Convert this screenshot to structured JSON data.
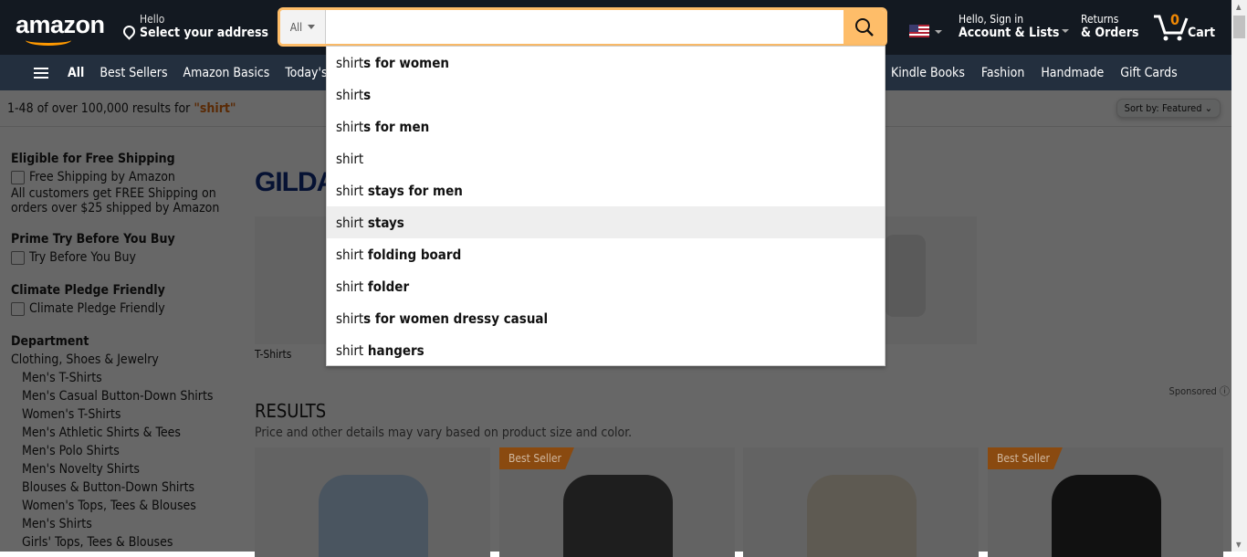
{
  "header": {
    "logo": "amazon",
    "hello": "Hello",
    "address": "Select your address",
    "search_category": "All",
    "search_value": "",
    "account_small": "Hello, Sign in",
    "account_big": "Account & Lists",
    "returns_small": "Returns",
    "returns_big": "& Orders",
    "cart_count": "0",
    "cart_label": "Cart"
  },
  "nav": {
    "all": "All",
    "items": [
      "Best Sellers",
      "Amazon Basics",
      "Today's Deals"
    ],
    "right_items": [
      "Kindle Books",
      "Fashion",
      "Handmade",
      "Gift Cards"
    ]
  },
  "results_bar": {
    "count": "1-48 of over 100,000 results for ",
    "query": "\"shirt\"",
    "sort_label": "Sort by:",
    "sort_value": "Featured"
  },
  "sidebar": {
    "shipping_title": "Eligible for Free Shipping",
    "shipping_option": "Free Shipping by Amazon",
    "shipping_note": "All customers get FREE Shipping on orders over $25 shipped by Amazon",
    "prime_title": "Prime Try Before You Buy",
    "prime_option": "Try Before You Buy",
    "climate_title": "Climate Pledge Friendly",
    "climate_option": "Climate Pledge Friendly",
    "dept_title": "Department",
    "dept_root": "Clothing, Shoes & Jewelry",
    "departments": [
      "Men's T-Shirts",
      "Men's Casual Button-Down Shirts",
      "Women's T-Shirts",
      "Men's Athletic Shirts & Tees",
      "Men's Polo Shirts",
      "Men's Novelty Shirts",
      "Blouses & Button-Down Shirts",
      "Women's Tops, Tees & Blouses",
      "Men's Shirts",
      "Girls' Tops, Tees & Blouses"
    ]
  },
  "main": {
    "brand": "GILDAN",
    "brand_tile": "T-Shirts",
    "sponsored": "Sponsored",
    "results_title": "RESULTS",
    "results_desc": "Price and other details may vary based on product size and color.",
    "badge": "Best Seller"
  },
  "suggestions": [
    {
      "prefix": "shirt",
      "suffix": "s for women"
    },
    {
      "prefix": "shirt",
      "suffix": "s"
    },
    {
      "prefix": "shirt",
      "suffix": "s for men"
    },
    {
      "prefix": "shirt",
      "suffix": ""
    },
    {
      "prefix": "shirt",
      "suffix": " stays for men"
    },
    {
      "prefix": "shirt",
      "suffix": " stays"
    },
    {
      "prefix": "shirt",
      "suffix": " folding board"
    },
    {
      "prefix": "shirt",
      "suffix": " folder"
    },
    {
      "prefix": "shirt",
      "suffix": "s for women dressy casual"
    },
    {
      "prefix": "shirt",
      "suffix": " hangers"
    }
  ],
  "colors": {
    "header": "#131921",
    "nav": "#232f3e",
    "accent": "#febd69",
    "badge": "#c45500"
  }
}
